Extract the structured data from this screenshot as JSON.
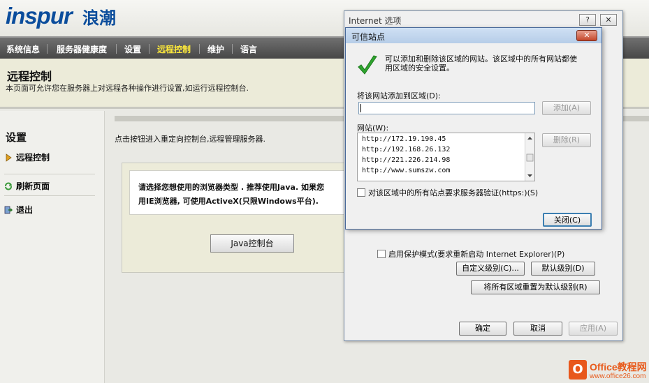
{
  "header": {
    "logo": "inspur",
    "logo_cn": "浪潮"
  },
  "nav": {
    "items": [
      {
        "label": "系统信息"
      },
      {
        "label": "服务器健康度"
      },
      {
        "label": "设置"
      },
      {
        "label": "远程控制"
      },
      {
        "label": "维护"
      },
      {
        "label": "语言"
      }
    ],
    "active_index": 3,
    "active_color": "#ffea3a"
  },
  "page": {
    "title": "远程控制",
    "description": "本页面可允许您在服务器上对远程各种操作进行设置,如运行远程控制台."
  },
  "sidebar": {
    "title": "设置",
    "items": [
      {
        "label": "远程控制",
        "icon": "arrow-right-icon"
      },
      {
        "label": "刷新页面",
        "icon": "refresh-icon"
      },
      {
        "label": "退出",
        "icon": "logout-icon"
      }
    ]
  },
  "main": {
    "intro": "点击按钮进入重定向控制台,远程管理服务器.",
    "browser_line1": "请选择您想使用的浏览器类型 . 推荐使用Java. 如果您",
    "browser_line2": "用IE浏览器, 可使用ActiveX(只限Windows平台).",
    "java_button": "Java控制台"
  },
  "internet_options": {
    "title": "Internet 选项",
    "help_label": "?",
    "close_label": "✕",
    "protect_mode": "启用保护模式(要求重新启动 Internet Explorer)(P)",
    "custom_level": "自定义级别(C)...",
    "default_level": "默认级别(D)",
    "reset_all": "将所有区域重置为默认级别(R)",
    "ok": "确定",
    "cancel": "取消",
    "apply": "应用(A)"
  },
  "trusted_sites": {
    "title": "可信站点",
    "message_line1": "可以添加和删除该区域的网站。该区域中的所有网站都使",
    "message_line2": "用区域的安全设置。",
    "add_label": "将该网站添加到区域(D):",
    "input_value": "",
    "add_button": "添加(A)",
    "websites_label": "网站(W):",
    "websites": [
      "http://172.19.190.45",
      "http://192.168.26.132",
      "http://221.226.214.98",
      "http://www.sumszw.com"
    ],
    "remove_button": "删除(R)",
    "verify_label": "对该区域中的所有站点要求服务器验证(https:)(S)",
    "close_button": "关闭(C)",
    "close_icon": "✕"
  },
  "watermark": {
    "icon_letter": "O",
    "line1": "Office教程网",
    "line2": "www.office26.com"
  }
}
